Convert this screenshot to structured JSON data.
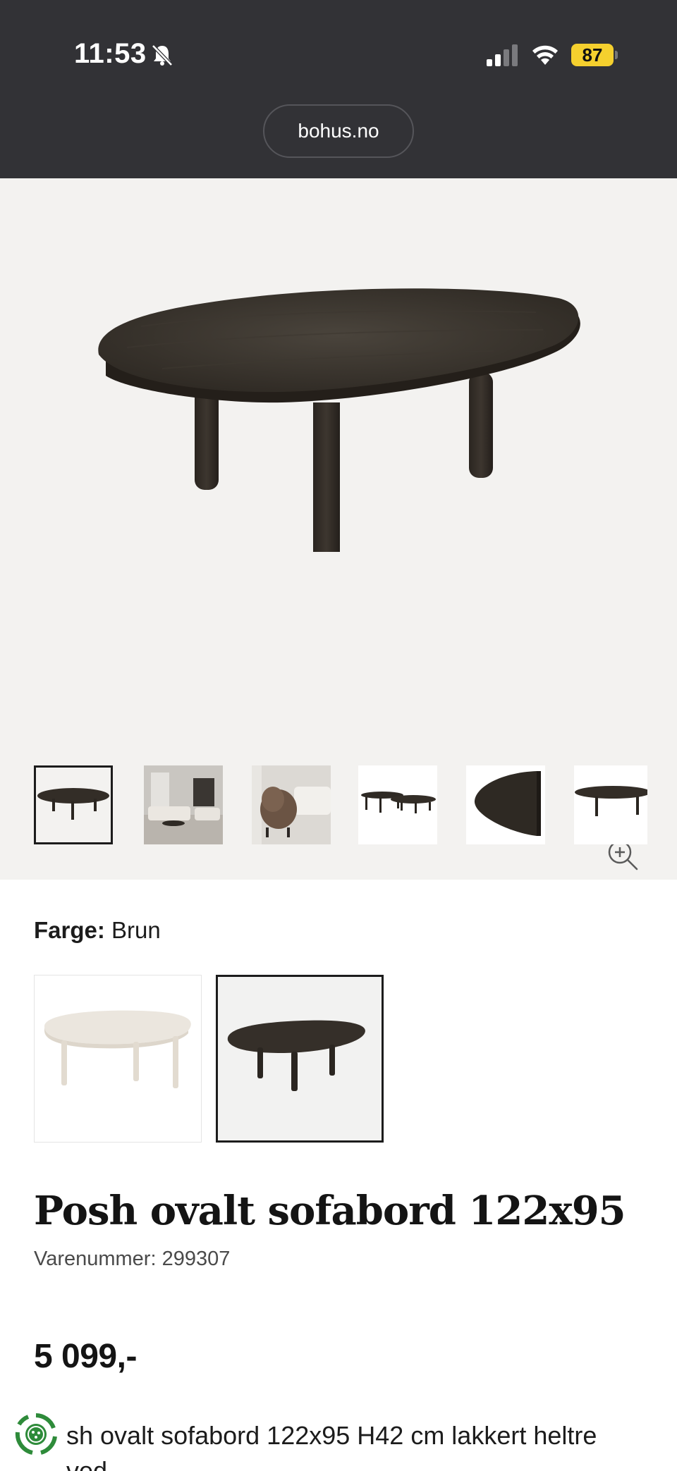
{
  "status_bar": {
    "time": "11:53",
    "battery": "87",
    "battery_color": "#f5d02e"
  },
  "browser": {
    "url": "bohus.no"
  },
  "gallery": {
    "zoom_icon": "zoom-in-icon",
    "thumbnails": [
      {
        "name": "thumb-product-dark",
        "active": true
      },
      {
        "name": "thumb-living-room"
      },
      {
        "name": "thumb-armchair"
      },
      {
        "name": "thumb-table-set"
      },
      {
        "name": "thumb-detail-edge"
      },
      {
        "name": "thumb-side-view"
      }
    ]
  },
  "color": {
    "label": "Farge:",
    "value": "Brun",
    "options": [
      "light-wood",
      "brown"
    ]
  },
  "product": {
    "title": "Posh ovalt sofabord 122x95",
    "sku": "Varenummer: 299307",
    "price": "5 099,-",
    "description": "sh ovalt sofabord 122x95 H42 cm lakkert heltre",
    "description_line2": "ved"
  },
  "colors": {
    "chrome": "#323236",
    "hero_bg": "#f3f2f0",
    "table_dark": "#35302a",
    "accent_green": "#2e8b3a"
  }
}
